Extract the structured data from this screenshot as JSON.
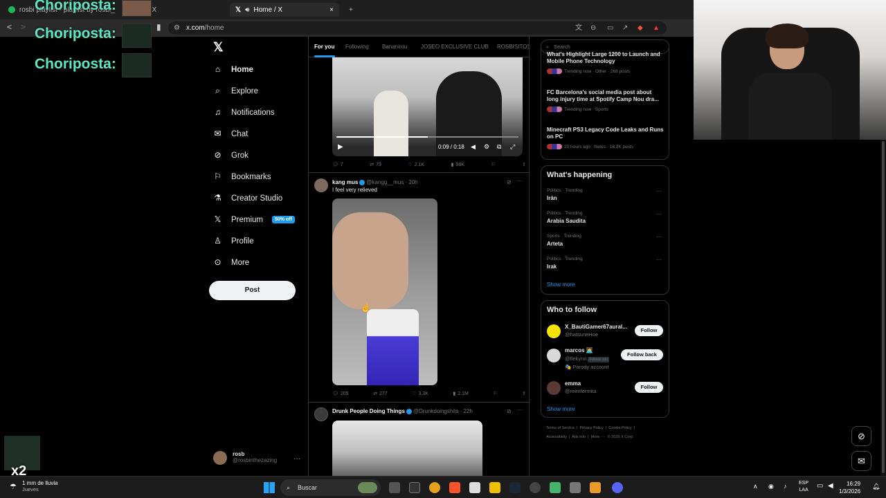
{
  "browser": {
    "tabs": [
      {
        "label": "rosbi playlist - playlist by rosbi_tpx - Spotify"
      },
      {
        "label": "/ X"
      },
      {
        "label": "Home / X"
      }
    ],
    "url_host": "x.com",
    "url_path": "/home",
    "new_tab": "+",
    "close_tab": "×"
  },
  "overlay": {
    "chat_lines": [
      "Choriposta:",
      "Choriposta:",
      "Choriposta:"
    ],
    "multiplier": "x2"
  },
  "nav": {
    "logo": "X",
    "items": [
      {
        "label": "Home",
        "icon": "home-icon"
      },
      {
        "label": "Explore",
        "icon": "search-icon"
      },
      {
        "label": "Notifications",
        "icon": "bell-icon"
      },
      {
        "label": "Chat",
        "icon": "chat-icon"
      },
      {
        "label": "Grok",
        "icon": "grok-icon"
      },
      {
        "label": "Bookmarks",
        "icon": "bookmark-icon"
      },
      {
        "label": "Creator Studio",
        "icon": "creator-icon"
      },
      {
        "label": "Premium",
        "icon": "x-icon"
      },
      {
        "label": "Profile",
        "icon": "person-icon"
      },
      {
        "label": "More",
        "icon": "more-icon"
      }
    ],
    "premium_badge": "50% off",
    "post_button": "Post",
    "account": {
      "name": "rosb",
      "handle": "@rosbinthezazing",
      "more": "···"
    }
  },
  "feed": {
    "tabs": [
      "For you",
      "Following",
      "Bananirou",
      "JOSEO EXCLUSIVE CLUB",
      "ROSBISITOS"
    ],
    "active_tab": 0,
    "tweets": [
      {
        "video_time": "0:09 / 0:18",
        "replies": "7",
        "retweets": "73",
        "likes": "2.1K",
        "views": "98K"
      },
      {
        "name": "kang mus",
        "handle": "@kangg__mus · 20h",
        "text": "I feel very relieved",
        "replies": "205",
        "retweets": "277",
        "likes": "3.3K",
        "views": "2.1M"
      },
      {
        "name": "Drunk People Doing Things",
        "handle": "@Drunkdoingshits · 22h"
      }
    ]
  },
  "sidebar": {
    "search_placeholder": "Search",
    "news": [
      {
        "title": "What's Highlight Large 1200 to Launch and Mobile Phone Technology",
        "meta": "Trending now · Other · 268 posts"
      },
      {
        "title": "FC Barcelona's social media post about long injury time at Spotify Camp Nou dra...",
        "meta": "Trending now · Sports"
      },
      {
        "title": "Minecraft PS3 Legacy Code Leaks and Runs on PC",
        "meta": "20 hours ago · News · 18.2K posts"
      }
    ],
    "happening": {
      "title": "What's happening",
      "trends": [
        {
          "category": "Politics · Trending",
          "name": "Irán"
        },
        {
          "category": "Politics · Trending",
          "name": "Arabia Saudita"
        },
        {
          "category": "Sports · Trending",
          "name": "Arteta"
        },
        {
          "category": "Politics · Trending",
          "name": "Irak"
        }
      ],
      "show_more": "Show more"
    },
    "who_to_follow": {
      "title": "Who to follow",
      "users": [
        {
          "name": "X_BautiGamer67aural...",
          "handle": "@hatsuneHoe",
          "button": "Follow",
          "color": "#f4e400"
        },
        {
          "name": "marcos 🧑‍💻",
          "handle": "@flekynn",
          "badge": "Follows you",
          "note": "🎭 Parody account",
          "button": "Follow back",
          "color": "#d8d8d8"
        },
        {
          "name": "emma",
          "handle": "@reenfermita",
          "button": "Follow",
          "color": "#5a3a33"
        }
      ],
      "show_more": "Show more"
    },
    "footer": [
      "Terms of Service",
      "Privacy Policy",
      "Cookie Policy",
      "Accessibility",
      "Ads info",
      "More ···",
      "© 2026 X Corp."
    ]
  },
  "taskbar": {
    "weather_line1": "1 mm de lluvia",
    "weather_line2": "Jueves",
    "search": "Buscar",
    "lang_line1": "ESP",
    "lang_line2": "LAA",
    "time": "16:29",
    "date": "1/3/2026"
  }
}
